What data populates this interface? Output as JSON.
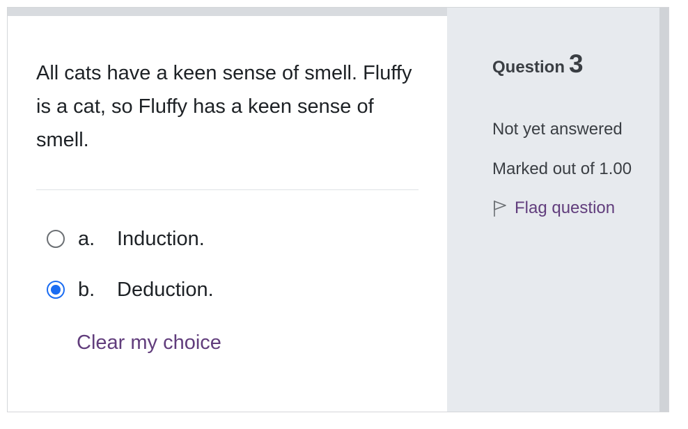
{
  "question": {
    "text": "All cats have a keen sense of smell. Fluffy is a cat, so Fluffy has a keen sense of smell.",
    "options": [
      {
        "letter": "a.",
        "text": "Induction.",
        "selected": false
      },
      {
        "letter": "b.",
        "text": "Deduction.",
        "selected": true
      }
    ],
    "clear_label": "Clear my choice"
  },
  "info": {
    "question_label": "Question",
    "question_number": "3",
    "state": "Not yet answered",
    "grade": "Marked out of 1.00",
    "flag_label": "Flag question",
    "flag_icon": "flag-icon"
  },
  "colors": {
    "accent_link": "#613d7c",
    "radio_selected": "#1a6cf2",
    "info_background": "#e7eaee"
  }
}
